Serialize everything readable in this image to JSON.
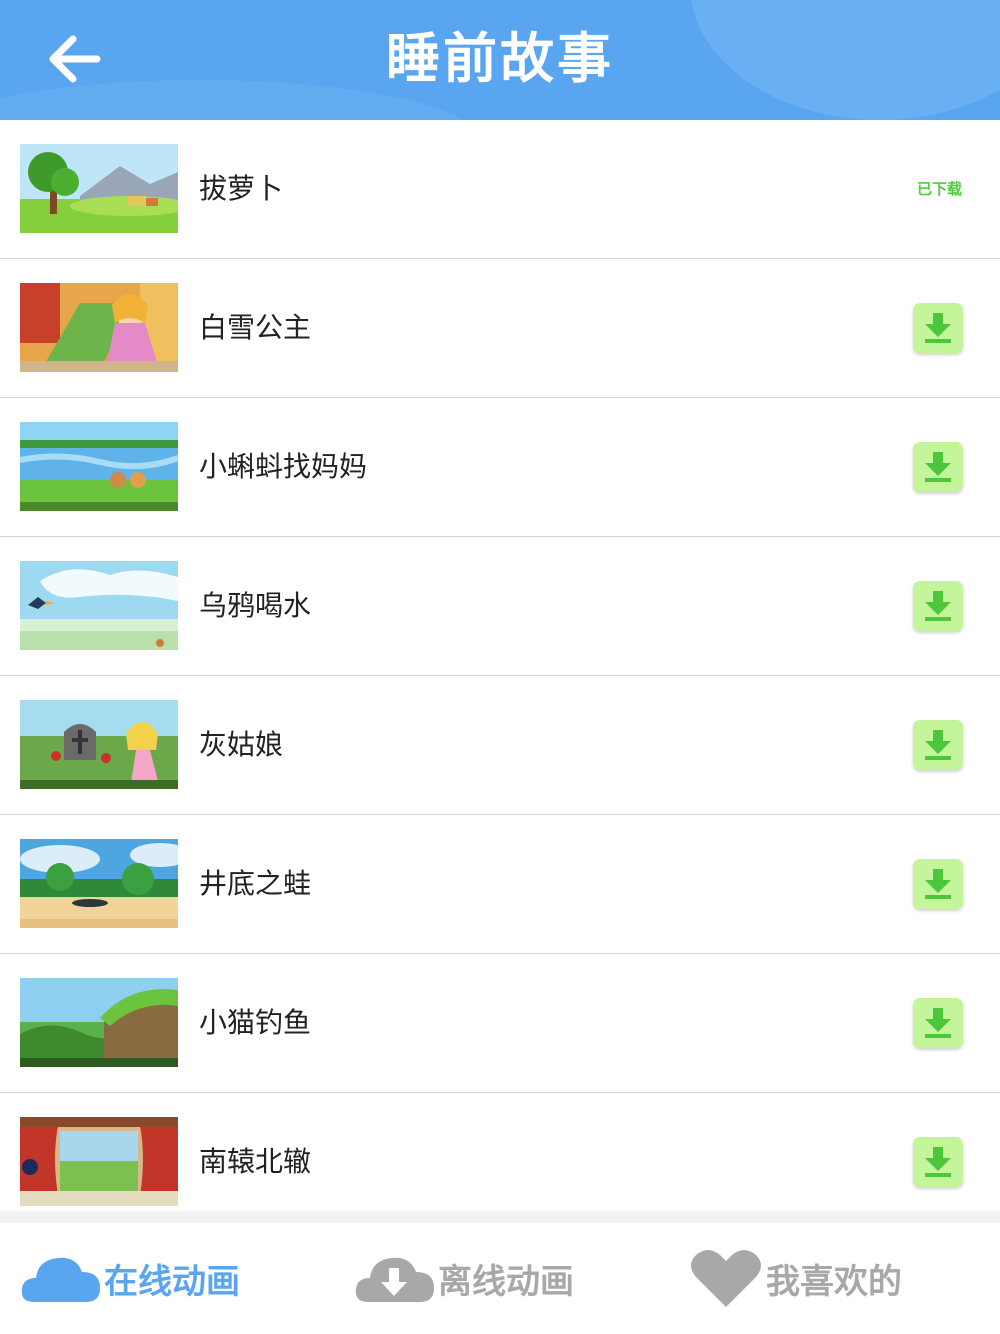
{
  "header": {
    "title": "睡前故事"
  },
  "stories": [
    {
      "name": "拔萝卜",
      "status": "已下载"
    },
    {
      "name": "白雪公主",
      "status": ""
    },
    {
      "name": "小蝌蚪找妈妈",
      "status": ""
    },
    {
      "name": "乌鸦喝水",
      "status": ""
    },
    {
      "name": "灰姑娘",
      "status": ""
    },
    {
      "name": "井底之蛙",
      "status": ""
    },
    {
      "name": "小猫钓鱼",
      "status": ""
    },
    {
      "name": "南辕北辙",
      "status": ""
    }
  ],
  "tabs": [
    {
      "label": "在线动画",
      "icon": "cloud-icon",
      "active": true
    },
    {
      "label": "离线动画",
      "icon": "cloud-download-icon",
      "active": false
    },
    {
      "label": "我喜欢的",
      "icon": "heart-icon",
      "active": false
    }
  ],
  "colors": {
    "header": "#5aa5ef",
    "tab_active": "#5aa5ef",
    "tab_inactive": "#a8a8a8",
    "download_bg": "#c4f59a",
    "download_icon": "#4cc63a",
    "downloaded_text": "#4fcc3c"
  }
}
